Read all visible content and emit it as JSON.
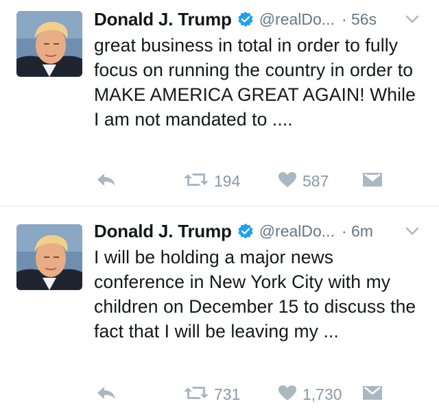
{
  "tweets": [
    {
      "author_name": "Donald J. Trump",
      "handle": "@realDo...",
      "time": "· 56s",
      "text": "great business in total in order to fully focus on running the country in order to MAKE AMERICA GREAT AGAIN! While I am not mandated to ....",
      "retweets": "194",
      "likes": "587"
    },
    {
      "author_name": "Donald J. Trump",
      "handle": "@realDo...",
      "time": "· 6m",
      "text": "I will be holding a major news conference in New York City with my children on December 15 to discuss the fact that I will be leaving my ...",
      "retweets": "731",
      "likes": "1,730"
    }
  ],
  "icons": {
    "verified": "verified-badge-icon",
    "menu": "chevron-down-icon",
    "reply": "reply-icon",
    "retweet": "retweet-icon",
    "like": "heart-icon",
    "message": "direct-message-icon"
  },
  "colors": {
    "text": "#14171a",
    "meta": "#657786",
    "action_icon": "#aab8c2",
    "verified": "#1da1f2",
    "divider": "#e1e8ed"
  }
}
